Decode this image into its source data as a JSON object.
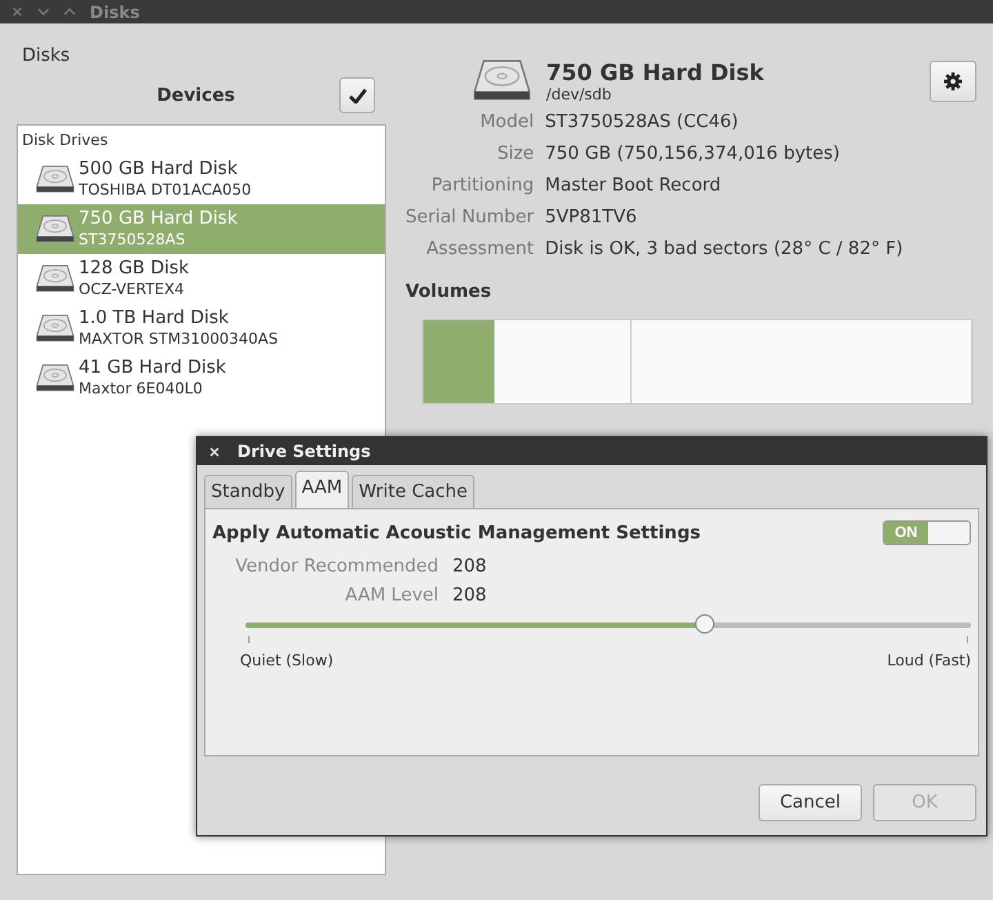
{
  "window": {
    "title": "Disks"
  },
  "header": {
    "title": "Disks"
  },
  "devices": {
    "heading": "Devices",
    "section": "Disk Drives",
    "drives": [
      {
        "name": "500 GB Hard Disk",
        "model": "TOSHIBA DT01ACA050",
        "selected": false
      },
      {
        "name": "750 GB Hard Disk",
        "model": "ST3750528AS",
        "selected": true
      },
      {
        "name": "128 GB Disk",
        "model": "OCZ-VERTEX4",
        "selected": false
      },
      {
        "name": "1.0 TB Hard Disk",
        "model": "MAXTOR STM31000340AS",
        "selected": false
      },
      {
        "name": "41 GB Hard Disk",
        "model": "Maxtor 6E040L0",
        "selected": false
      }
    ]
  },
  "detail": {
    "title": "750 GB Hard Disk",
    "device": "/dev/sdb",
    "fields": [
      {
        "label": "Model",
        "value": "ST3750528AS (CC46)"
      },
      {
        "label": "Size",
        "value": "750 GB (750,156,374,016 bytes)"
      },
      {
        "label": "Partitioning",
        "value": "Master Boot Record"
      },
      {
        "label": "Serial Number",
        "value": "5VP81TV6"
      },
      {
        "label": "Assessment",
        "value": "Disk is OK, 3 bad sectors (28° C / 82° F)"
      }
    ],
    "volumes_heading": "Volumes",
    "volume_segments": [
      {
        "selected": true
      },
      {
        "selected": false
      },
      {
        "selected": false
      }
    ]
  },
  "dialog": {
    "title": "Drive Settings",
    "tabs": [
      {
        "label": "Standby",
        "selected": false
      },
      {
        "label": "AAM",
        "selected": true
      },
      {
        "label": "Write Cache",
        "selected": false
      }
    ],
    "heading": "Apply Automatic Acoustic Management Settings",
    "switch": {
      "label": "ON",
      "on": true
    },
    "rows": [
      {
        "label": "Vendor Recommended",
        "value": "208"
      },
      {
        "label": "AAM Level",
        "value": "208"
      }
    ],
    "slider": {
      "level": 0.634,
      "min_label": "Quiet (Slow)",
      "max_label": "Loud (Fast)"
    },
    "buttons": [
      {
        "label": "Cancel",
        "disabled": false
      },
      {
        "label": "OK",
        "disabled": true
      }
    ]
  }
}
